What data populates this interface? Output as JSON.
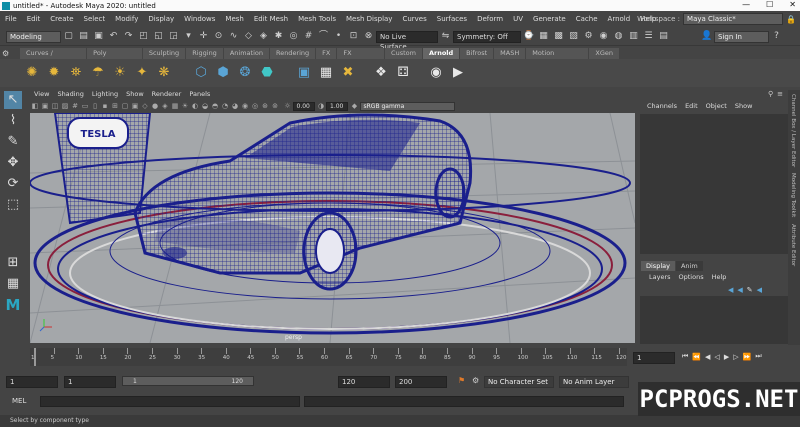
{
  "window": {
    "title": "untitled* - Autodesk Maya 2020: untitled",
    "minimize": "—",
    "maximize": "☐",
    "close": "✕"
  },
  "menu": [
    "File",
    "Edit",
    "Create",
    "Select",
    "Modify",
    "Display",
    "Windows",
    "Mesh",
    "Edit Mesh",
    "Mesh Tools",
    "Mesh Display",
    "Curves",
    "Surfaces",
    "Deform",
    "UV",
    "Generate",
    "Cache",
    "Arnold",
    "Help"
  ],
  "workspace": {
    "label": "Workspace :",
    "value": "Maya Classic*"
  },
  "status": {
    "mode": "Modeling",
    "live_surface": "No Live Surface",
    "symmetry": "Symmetry: Off",
    "sign_in": "Sign In"
  },
  "shelf_tabs": [
    {
      "label": "Curves / Surfaces",
      "active": false
    },
    {
      "label": "Poly Modeling",
      "active": false
    },
    {
      "label": "Sculpting",
      "active": false
    },
    {
      "label": "Rigging",
      "active": false
    },
    {
      "label": "Animation",
      "active": false
    },
    {
      "label": "Rendering",
      "active": false
    },
    {
      "label": "FX",
      "active": false
    },
    {
      "label": "FX Caching",
      "active": false
    },
    {
      "label": "Custom",
      "active": false
    },
    {
      "label": "Arnold",
      "active": true
    },
    {
      "label": "Bifrost",
      "active": false
    },
    {
      "label": "MASH",
      "active": false
    },
    {
      "label": "Motion Graphics",
      "active": false
    },
    {
      "label": "XGen",
      "active": false
    }
  ],
  "viewport_menu": [
    "View",
    "Shading",
    "Lighting",
    "Show",
    "Renderer",
    "Panels"
  ],
  "viewport_fields": {
    "near": "0.00",
    "far": "1.00",
    "color_space": "sRGB gamma"
  },
  "viewport_label": "persp",
  "scene_sign_text": "TESLA",
  "channel_box": {
    "tabs": [
      "Channels",
      "Edit",
      "Object",
      "Show"
    ]
  },
  "layer_editor": {
    "tabs": [
      {
        "label": "Display",
        "active": true
      },
      {
        "label": "Anim",
        "active": false
      }
    ],
    "menu": [
      "Layers",
      "Options",
      "Help"
    ]
  },
  "side_tabs": [
    "Channel Box / Layer Editor",
    "Modeling Toolkit",
    "Attribute Editor"
  ],
  "timeline": {
    "ticks": [
      1,
      5,
      10,
      15,
      20,
      25,
      30,
      35,
      40,
      45,
      50,
      55,
      60,
      65,
      70,
      75,
      80,
      85,
      90,
      95,
      100,
      105,
      110,
      115,
      120
    ],
    "current_frame": "1"
  },
  "range": {
    "start": "1",
    "anim_start": "1",
    "range_start": "1",
    "range_end": "120",
    "end": "120",
    "anim_end": "200",
    "character_set": "No Character Set",
    "anim_layer": "No Anim Layer"
  },
  "mel": {
    "label": "MEL"
  },
  "help_line": "Select by component type",
  "watermark": "PCPROGS.NET",
  "colors": {
    "wire": "#1a1f8c",
    "viewport_bg": "#a4a7aa",
    "select_blue": "#5285a6"
  }
}
